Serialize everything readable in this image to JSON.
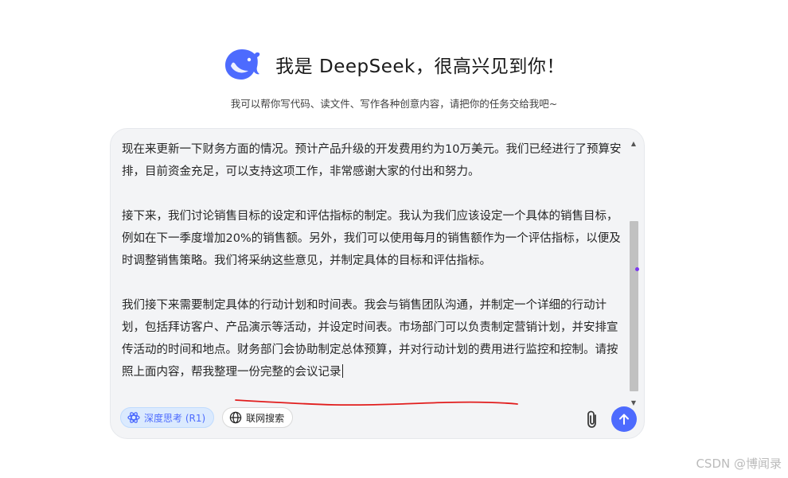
{
  "header": {
    "title": "我是 DeepSeek，很高兴见到你！",
    "subtitle": "我可以帮你写代码、读文件、写作各种创意内容，请把你的任务交给我吧~"
  },
  "input": {
    "paragraphs": [
      "现在来更新一下财务方面的情况。预计产品升级的开发费用约为10万美元。我们已经进行了预算安排，目前资金充足，可以支持这项工作，非常感谢大家的付出和努力。",
      "接下来，我们讨论销售目标的设定和评估指标的制定。我认为我们应该设定一个具体的销售目标，例如在下一季度增加20%的销售额。另外，我们可以使用每月的销售额作为一个评估指标，以便及时调整销售策略。我们将采纳这些意见，并制定具体的目标和评估指标。"
    ],
    "last_paragraph": "我们接下来需要制定具体的行动计划和时间表。我会与销售团队沟通，并制定一个详细的行动计划，包括拜访客户、产品演示等活动，并设定时间表。市场部门可以负责制定营销计划，并安排宣传活动的时间和地点。财务部门会协助制定总体预算，并对行动计划的费用进行监控和控制。",
    "request_text": "请按照上面内容，帮我整理一份完整的会议记录"
  },
  "toolbar": {
    "deep_think_label": "深度思考 (R1)",
    "web_search_label": "联网搜索"
  },
  "icons": {
    "logo": "deepseek-whale-logo",
    "deep_think": "atom-icon",
    "web_search": "globe-icon",
    "attach": "paperclip-icon",
    "send": "arrow-up-icon"
  },
  "colors": {
    "brand": "#4d6bfe",
    "annotation": "#e11d1d"
  },
  "watermark": "CSDN @博闻录"
}
